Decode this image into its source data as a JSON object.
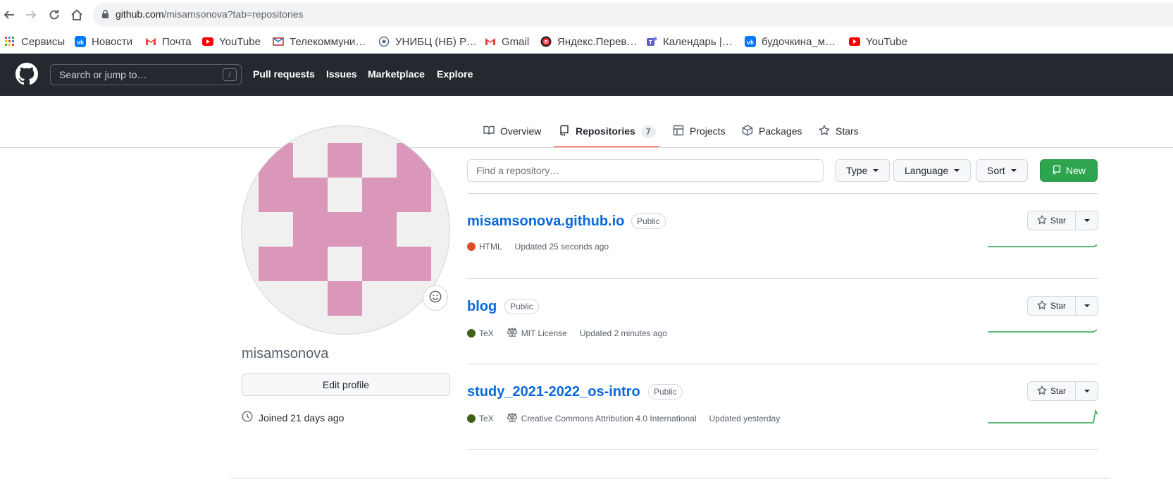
{
  "browser": {
    "url_host": "github.com",
    "url_path": "/misamsonova?tab=repositories"
  },
  "bookmarks": [
    {
      "label": "Сервисы",
      "icon": "apps-grid-icon"
    },
    {
      "label": "Новости",
      "icon": "vk-icon"
    },
    {
      "label": "Почта",
      "icon": "gmail-icon"
    },
    {
      "label": "YouTube",
      "icon": "youtube-icon"
    },
    {
      "label": "Телекоммуни…",
      "icon": "telecom-icon"
    },
    {
      "label": "УНИБЦ (НБ) Р…",
      "icon": "library-icon"
    },
    {
      "label": "Gmail",
      "icon": "gmail-icon"
    },
    {
      "label": "Яндекс.Перев…",
      "icon": "yandex-translate-icon"
    },
    {
      "label": "Календарь |…",
      "icon": "teams-icon"
    },
    {
      "label": "будочкина_м…",
      "icon": "vk-icon"
    },
    {
      "label": "YouTube",
      "icon": "youtube-icon"
    }
  ],
  "header": {
    "search_placeholder": "Search or jump to…",
    "search_key": "/",
    "nav": [
      "Pull requests",
      "Issues",
      "Marketplace",
      "Explore"
    ]
  },
  "tabs": [
    {
      "label": "Overview",
      "icon": "book-icon"
    },
    {
      "label": "Repositories",
      "icon": "repo-icon",
      "count": "7",
      "active": true
    },
    {
      "label": "Projects",
      "icon": "table-icon"
    },
    {
      "label": "Packages",
      "icon": "package-icon"
    },
    {
      "label": "Stars",
      "icon": "star-icon"
    }
  ],
  "profile": {
    "username": "misamsonova",
    "edit_label": "Edit profile",
    "joined": "Joined 21 days ago",
    "avatar_color": "#db97b9"
  },
  "controls": {
    "find_placeholder": "Find a repository…",
    "type_label": "Type",
    "language_label": "Language",
    "sort_label": "Sort",
    "new_label": "New"
  },
  "repos": [
    {
      "name": "misamsonova.github.io",
      "visibility": "Public",
      "language": "HTML",
      "language_color": "#e34c26",
      "license": "",
      "updated": "Updated 25 seconds ago",
      "star_label": "Star"
    },
    {
      "name": "blog",
      "visibility": "Public",
      "language": "TeX",
      "language_color": "#3d6117",
      "license": "MIT License",
      "updated": "Updated 2 minutes ago",
      "star_label": "Star"
    },
    {
      "name": "study_2021-2022_os-intro",
      "visibility": "Public",
      "language": "TeX",
      "language_color": "#3d6117",
      "license": "Creative Commons Attribution 4.0 International",
      "updated": "Updated yesterday",
      "star_label": "Star"
    }
  ],
  "colors": {
    "header_bg": "#24292f",
    "link": "#0969da",
    "new_button": "#2da44e",
    "tab_underline": "#fd8c73",
    "sparkline": "#2da44e"
  }
}
